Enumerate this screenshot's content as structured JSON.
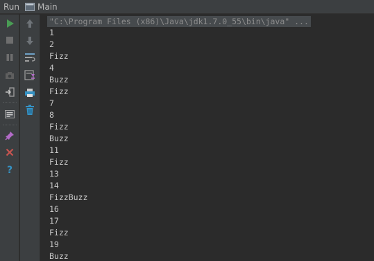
{
  "titlebar": {
    "run_label": "Run",
    "tab_label": "Main"
  },
  "toolbar_left": [
    {
      "icon": "run-icon",
      "color": "#499c54"
    },
    {
      "icon": "stop-icon",
      "color": "#6e6e6e"
    },
    {
      "icon": "pause-icon",
      "color": "#6e6e6e"
    },
    {
      "icon": "dump-threads-icon",
      "color": "#6e6e6e"
    },
    {
      "icon": "exit-icon",
      "color": "#9a9a9a"
    },
    {
      "icon": "settings-icon",
      "color": "#9a9a9a"
    },
    {
      "icon": "pin-icon",
      "color": "#b36bc8"
    },
    {
      "icon": "close-icon",
      "color": "#c75450"
    },
    {
      "icon": "help-icon",
      "color": "#3592c4"
    }
  ],
  "toolbar_right": [
    {
      "icon": "arrow-up-icon"
    },
    {
      "icon": "arrow-down-icon"
    },
    {
      "icon": "soft-wrap-icon"
    },
    {
      "icon": "scroll-to-end-icon"
    },
    {
      "icon": "print-icon"
    },
    {
      "icon": "clear-all-icon"
    }
  ],
  "console": {
    "command": "\"C:\\Program Files (x86)\\Java\\jdk1.7.0_55\\bin\\java\" ...",
    "lines": [
      "1",
      "2",
      "Fizz",
      "4",
      "Buzz",
      "Fizz",
      "7",
      "8",
      "Fizz",
      "Buzz",
      "11",
      "Fizz",
      "13",
      "14",
      "FizzBuzz",
      "16",
      "17",
      "Fizz",
      "19",
      "Buzz"
    ]
  }
}
